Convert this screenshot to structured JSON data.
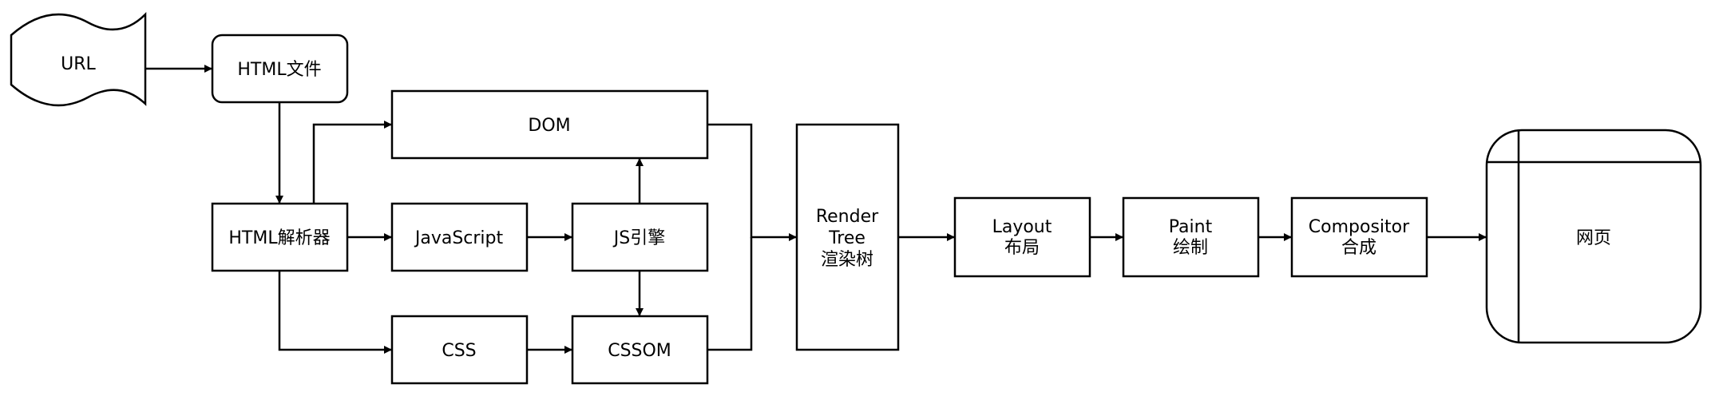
{
  "nodes": {
    "url": "URL",
    "html_file": "HTML文件",
    "dom": "DOM",
    "html_parser": "HTML解析器",
    "javascript": "JavaScript",
    "js_engine": "JS引擎",
    "css": "CSS",
    "cssom": "CSSOM",
    "render_tree": [
      "Render",
      "Tree",
      "渲染树"
    ],
    "layout": [
      "Layout",
      "布局"
    ],
    "paint": [
      "Paint",
      "绘制"
    ],
    "compositor": [
      "Compositor",
      "合成"
    ],
    "webpage": "网页"
  },
  "colors": {
    "stroke": "#000000",
    "fill": "#ffffff",
    "background": "#ffffff"
  }
}
